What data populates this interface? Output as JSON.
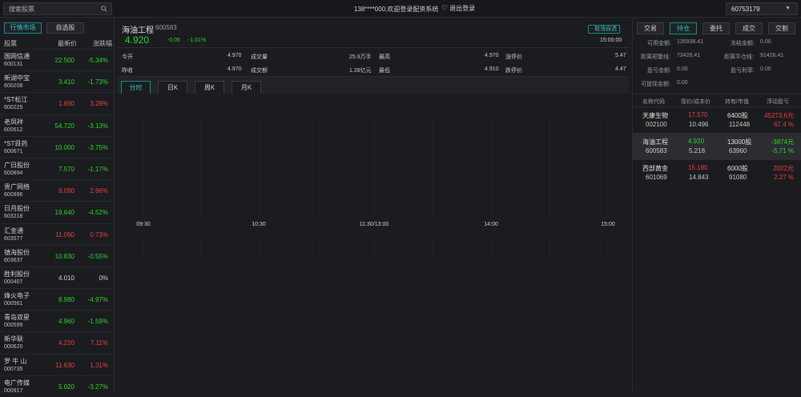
{
  "topbar": {
    "search_placeholder": "搜索股票",
    "welcome": "138****000,欢迎登录配资系统",
    "logout_label": "退出登录",
    "account": "60753179"
  },
  "left": {
    "tabs": [
      {
        "label": "行情市场",
        "active": true
      },
      {
        "label": "自选股",
        "active": false
      }
    ],
    "columns": [
      "股票",
      "最新价",
      "涨跌幅"
    ],
    "stocks": [
      {
        "name": "国网信通",
        "code": "600131",
        "price": "22.500",
        "pct": "-5.34%",
        "dir": "down"
      },
      {
        "name": "新湖中宝",
        "code": "600208",
        "price": "3.410",
        "pct": "-1.73%",
        "dir": "down"
      },
      {
        "name": "*ST松江",
        "code": "600225",
        "price": "1.890",
        "pct": "3.28%",
        "dir": "up"
      },
      {
        "name": "老凤祥",
        "code": "600612",
        "price": "54.720",
        "pct": "-3.13%",
        "dir": "down"
      },
      {
        "name": "*ST目药",
        "code": "600671",
        "price": "10.000",
        "pct": "-3.75%",
        "dir": "down"
      },
      {
        "name": "广日股份",
        "code": "600894",
        "price": "7.570",
        "pct": "-1.17%",
        "dir": "down"
      },
      {
        "name": "贵广网络",
        "code": "600996",
        "price": "8.090",
        "pct": "2.66%",
        "dir": "up"
      },
      {
        "name": "日月股份",
        "code": "603218",
        "price": "19.640",
        "pct": "-4.52%",
        "dir": "down"
      },
      {
        "name": "汇金通",
        "code": "603577",
        "price": "11.090",
        "pct": "0.73%",
        "dir": "up"
      },
      {
        "name": "镇海股份",
        "code": "603637",
        "price": "10.830",
        "pct": "-0.55%",
        "dir": "down"
      },
      {
        "name": "胜利股份",
        "code": "000407",
        "price": "4.010",
        "pct": "0%",
        "dir": "flat"
      },
      {
        "name": "烽火电子",
        "code": "000561",
        "price": "8.980",
        "pct": "-4.97%",
        "dir": "down"
      },
      {
        "name": "青岛双星",
        "code": "000599",
        "price": "4.960",
        "pct": "-1.59%",
        "dir": "down"
      },
      {
        "name": "新华联",
        "code": "000620",
        "price": "4.220",
        "pct": "7.11%",
        "dir": "up"
      },
      {
        "name": "罗 牛 山",
        "code": "000735",
        "price": "11.630",
        "pct": "1.31%",
        "dir": "up"
      },
      {
        "name": "电广传媒",
        "code": "000917",
        "price": "5.020",
        "pct": "-3.27%",
        "dir": "down"
      }
    ]
  },
  "quote": {
    "name": "海油工程",
    "code": "600583",
    "price": "4.920",
    "change": "-0.05",
    "pct": "-1.01%",
    "unwatch_label": "- 取消自选",
    "time": "15:00:00",
    "row1": [
      {
        "label": "今开",
        "value": "4.970"
      },
      {
        "label": "成交量",
        "value": "25.9万手"
      },
      {
        "label": "最高",
        "value": "4.970"
      },
      {
        "label": "涨停价",
        "value": "5.47"
      }
    ],
    "row2": [
      {
        "label": "昨收",
        "value": "4.970"
      },
      {
        "label": "成交额",
        "value": "1.28亿元"
      },
      {
        "label": "最低",
        "value": "4.910"
      },
      {
        "label": "跌停价",
        "value": "4.47"
      }
    ]
  },
  "chart_tabs": [
    {
      "label": "分时",
      "active": true
    },
    {
      "label": "日K",
      "active": false
    },
    {
      "label": "周K",
      "active": false
    },
    {
      "label": "月K",
      "active": false
    }
  ],
  "chart_axis": [
    "09:30",
    "10:30",
    "11:30/13:00",
    "14:00",
    "15:00"
  ],
  "right": {
    "tabs": [
      {
        "label": "交易",
        "active": false
      },
      {
        "label": "持仓",
        "active": true
      },
      {
        "label": "委托",
        "active": false
      },
      {
        "label": "成交",
        "active": false
      },
      {
        "label": "交割",
        "active": false
      }
    ],
    "account": {
      "available_label": "可用金额:",
      "available": "135938.41",
      "frozen_label": "冻结金额:",
      "frozen": "0.00",
      "warn_label": "距离预警线:",
      "warn": "73426.41",
      "close_label": "距离平仓线:",
      "close": "91426.41",
      "pnl_label": "盈亏金额:",
      "pnl": "0.00",
      "pnl_rate_label": "盈亏利率:",
      "pnl_rate": "0.00",
      "withdraw_label": "可提现金额:",
      "withdraw": "0.00"
    },
    "hold_columns": [
      "名称代码",
      "现价/成本价",
      "持有/市值",
      "浮动盈亏"
    ],
    "holdings": [
      {
        "name": "天康生物",
        "code": "002100",
        "price": "17.570",
        "cost": "10.496",
        "qty": "6400股",
        "value": "112448",
        "pnl": "45273.6元",
        "pnl_pct": "67.4 %",
        "dir": "up",
        "selected": false
      },
      {
        "name": "海油工程",
        "code": "600583",
        "price": "4.920",
        "cost": "5.218",
        "qty": "13000股",
        "value": "63960",
        "pnl": "-3874元",
        "pnl_pct": "-5.71 %",
        "dir": "down",
        "selected": true
      },
      {
        "name": "西部黄金",
        "code": "601069",
        "price": "15.180",
        "cost": "14.843",
        "qty": "6000股",
        "value": "91080",
        "pnl": "2022元",
        "pnl_pct": "2.27 %",
        "dir": "up",
        "selected": false
      }
    ]
  },
  "colors": {
    "up": "#e8403c",
    "down": "#2ed22e",
    "accent": "#3fc4c4"
  }
}
